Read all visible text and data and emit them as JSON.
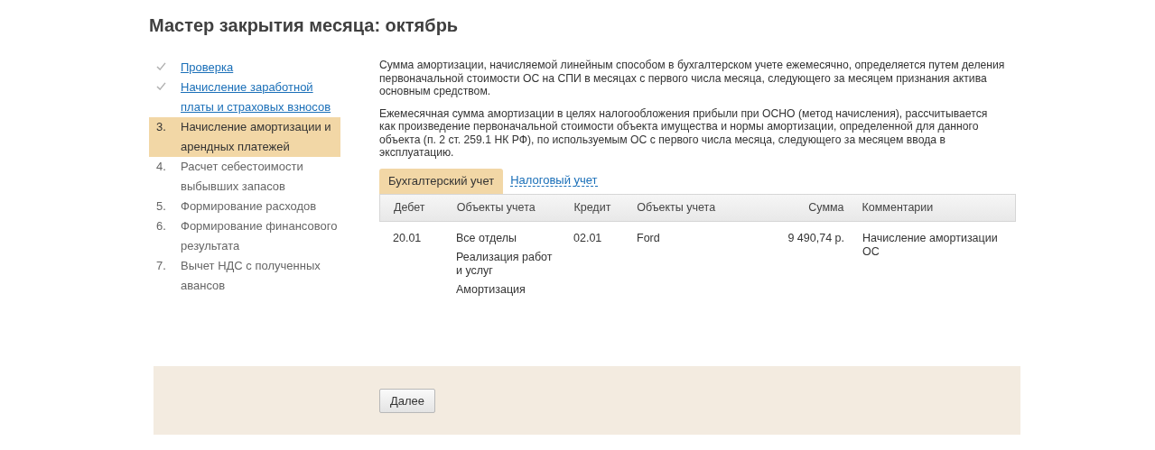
{
  "title": "Мастер закрытия месяца: октябрь",
  "steps": [
    {
      "kind": "done",
      "label": "Проверка",
      "selected": false
    },
    {
      "kind": "done",
      "label": "Начисление заработной платы и страховых взносов",
      "selected": false
    },
    {
      "kind": "numbered",
      "number": "3.",
      "label": "Начисление амортизации и арендных платежей",
      "selected": true
    },
    {
      "kind": "numbered",
      "number": "4.",
      "label": "Расчет себестоимости выбывших запасов",
      "selected": false
    },
    {
      "kind": "numbered",
      "number": "5.",
      "label": "Формирование расходов",
      "selected": false
    },
    {
      "kind": "numbered",
      "number": "6.",
      "label": "Формирование финансового результата",
      "selected": false
    },
    {
      "kind": "numbered",
      "number": "7.",
      "label": "Вычет НДС с полученных авансов",
      "selected": false
    }
  ],
  "paragraphs": [
    "Сумма амортизации, начисляемой линейным способом в бухгалтерском учете ежемесячно, определяется путем деления первоначальной стоимости ОС на СПИ в месяцах с первого числа месяца, следующего за месяцем признания актива основным средством.",
    "Ежемесячная сумма амортизации в целях налогообложения прибыли при ОСНО (метод начисления), рассчитывается как произведение первоначальной стоимости объекта имущества и нормы амортизации, определенной для данного объекта (п. 2 ст. 259.1 НК РФ), по используемым ОС с первого числа месяца, следующего за месяцем ввода в эксплуатацию."
  ],
  "tabs": [
    {
      "label": "Бухгалтерский учет",
      "selected": true
    },
    {
      "label": "Налоговый учет",
      "selected": false
    }
  ],
  "table": {
    "columns": [
      "Дебет",
      "Объекты учета",
      "Кредит",
      "Объекты учета",
      "Сумма",
      "Комментарии"
    ],
    "rows": [
      {
        "debit": "20.01",
        "debit_objects": [
          "Все отделы",
          "Реализация работ и услуг",
          "Амортизация"
        ],
        "credit": "02.01",
        "credit_objects": [
          "Ford"
        ],
        "amount": "9 490,74 р.",
        "comment": "Начисление амортизации ОС"
      }
    ]
  },
  "footer": {
    "button": "Далее"
  }
}
